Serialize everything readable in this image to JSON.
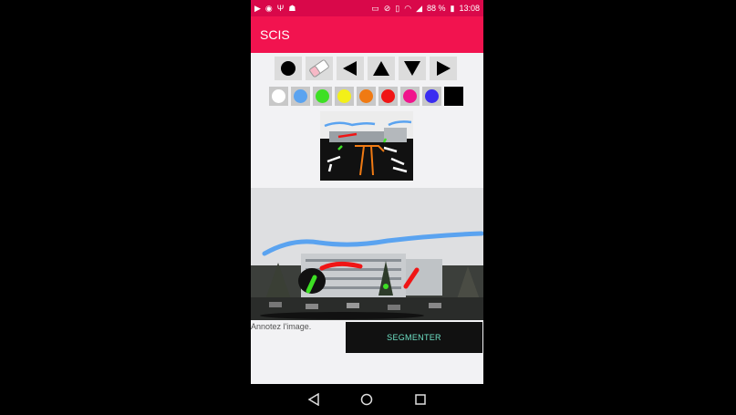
{
  "status_bar": {
    "time": "13:08",
    "battery": "88 %",
    "icons": [
      "video-icon",
      "camera-icon",
      "usb-icon",
      "android-icon",
      "cast-icon",
      "do-not-disturb-icon",
      "vibrate-icon",
      "wifi-icon",
      "signal-icon",
      "battery-icon"
    ]
  },
  "app_bar": {
    "title": "SCIS"
  },
  "toolbar": {
    "tools": [
      "brush-tool",
      "eraser-tool",
      "arrow-left",
      "arrow-up",
      "arrow-down",
      "arrow-right"
    ]
  },
  "palette": {
    "colors": [
      "#ffffff",
      "#5aa3f0",
      "#3de024",
      "#f3f019",
      "#f07a13",
      "#f01515",
      "#f0148c",
      "#3a2cf0",
      "#000000"
    ]
  },
  "main": {
    "hint_text": "Annotez l'image.",
    "segment_button_label": "SEGMENTER"
  },
  "nav_bar": {
    "icons": [
      "back-icon",
      "home-icon",
      "recents-icon"
    ]
  }
}
